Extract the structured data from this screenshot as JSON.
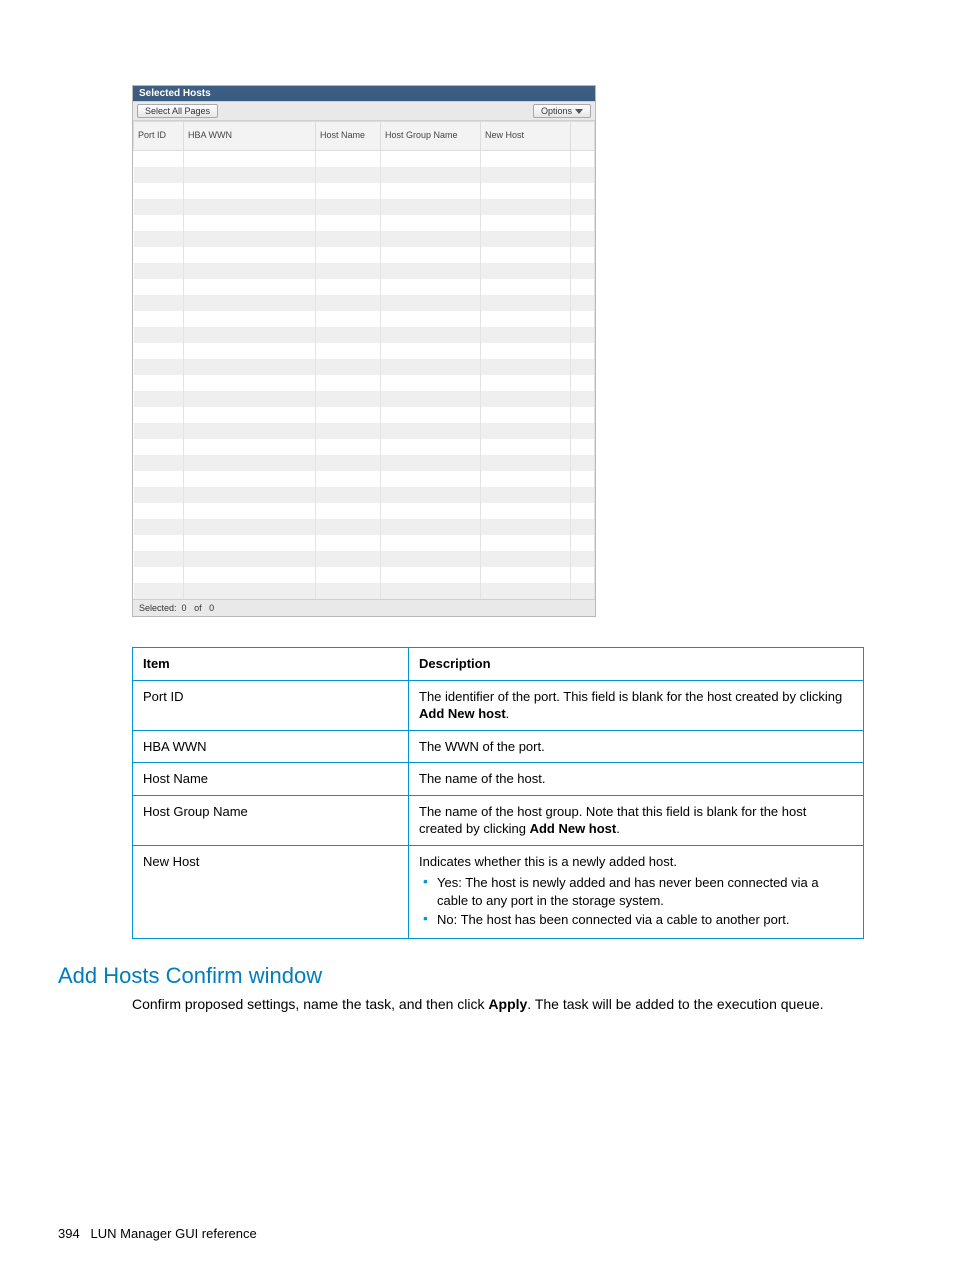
{
  "shot": {
    "title": "Selected Hosts",
    "selectAll": "Select All Pages",
    "options": "Options",
    "cols": {
      "port_id": "Port ID",
      "hba_wwn": "HBA WWN",
      "host_name": "Host Name",
      "host_group": "Host Group Name",
      "new_host": "New Host"
    },
    "footer_label": "Selected:",
    "footer_sel": "0",
    "footer_of": "of",
    "footer_total": "0"
  },
  "desc": {
    "h_item": "Item",
    "h_desc": "Description",
    "rows": [
      {
        "item": "Port ID",
        "text_a": "The identifier of the port. This field is blank for the host created by clicking ",
        "bold": "Add New host",
        "text_b": "."
      },
      {
        "item": "HBA WWN",
        "text_a": "The WWN of the port.",
        "bold": "",
        "text_b": ""
      },
      {
        "item": "Host Name",
        "text_a": "The name of the host.",
        "bold": "",
        "text_b": ""
      },
      {
        "item": "Host Group Name",
        "text_a": "The name of the host group. Note that this field is blank for the host created by clicking ",
        "bold": "Add New host",
        "text_b": "."
      }
    ],
    "row_newhost": {
      "item": "New Host",
      "lead": "Indicates whether this is a newly added host.",
      "li1": "Yes: The host is newly added and has never been connected via a cable to any port in the storage system.",
      "li2": "No: The host has been connected via a cable to another port."
    }
  },
  "section": {
    "heading": "Add Hosts Confirm window",
    "para_a": "Confirm proposed settings, name the task, and then click ",
    "para_bold": "Apply",
    "para_b": ". The task will be added to the execution queue."
  },
  "footer": {
    "page": "394",
    "title": "LUN Manager GUI reference"
  }
}
